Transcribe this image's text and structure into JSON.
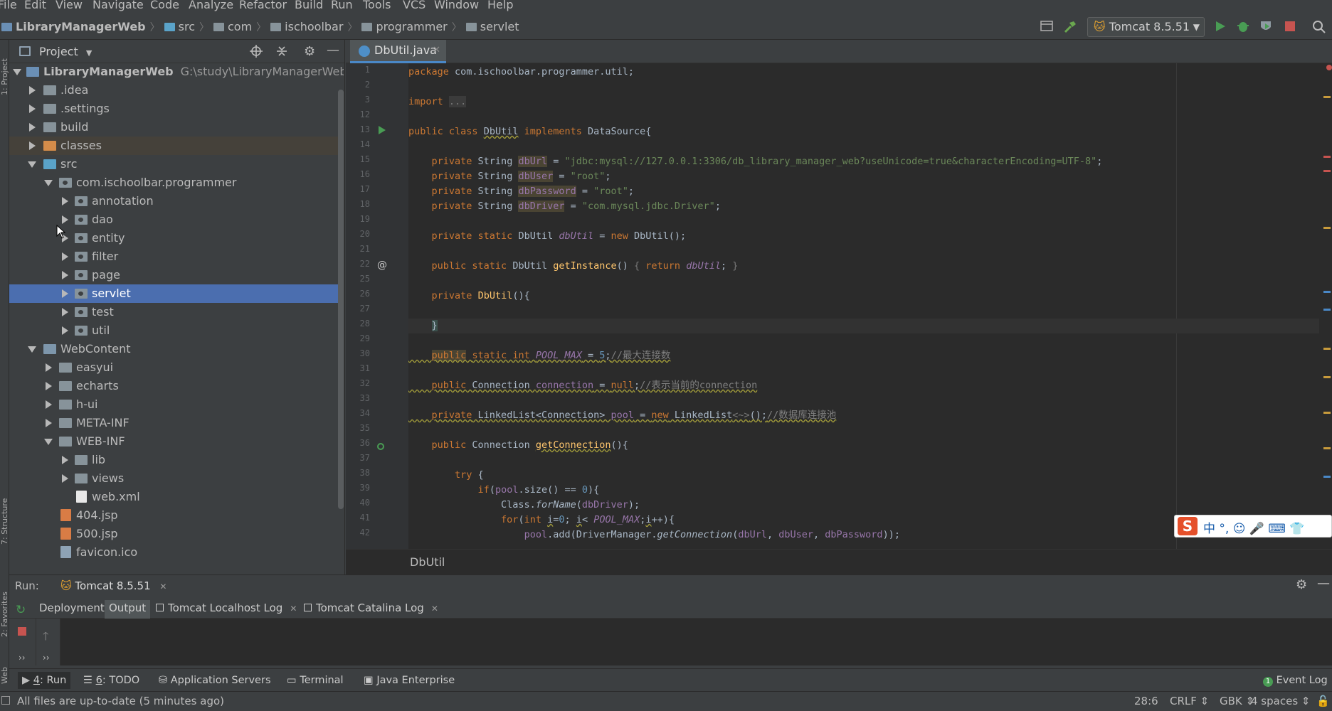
{
  "menu": [
    "File",
    "Edit",
    "View",
    "Navigate",
    "Code",
    "Analyze",
    "Refactor",
    "Build",
    "Run",
    "Tools",
    "VCS",
    "Window",
    "Help"
  ],
  "breadcrumb": [
    "LibraryManagerWeb",
    "src",
    "com",
    "ischoolbar",
    "programmer",
    "servlet"
  ],
  "run_config": "Tomcat 8.5.51",
  "project_panel": {
    "title": "Project",
    "tree": [
      {
        "label": "LibraryManagerWeb",
        "path": "G:\\study\\LibraryManagerWeb"
      },
      {
        "label": ".idea"
      },
      {
        "label": ".settings"
      },
      {
        "label": "build"
      },
      {
        "label": "classes"
      },
      {
        "label": "src"
      },
      {
        "label": "com.ischoolbar.programmer"
      },
      {
        "label": "annotation"
      },
      {
        "label": "dao"
      },
      {
        "label": "entity"
      },
      {
        "label": "filter"
      },
      {
        "label": "page"
      },
      {
        "label": "servlet"
      },
      {
        "label": "test"
      },
      {
        "label": "util"
      },
      {
        "label": "WebContent"
      },
      {
        "label": "easyui"
      },
      {
        "label": "echarts"
      },
      {
        "label": "h-ui"
      },
      {
        "label": "META-INF"
      },
      {
        "label": "WEB-INF"
      },
      {
        "label": "lib"
      },
      {
        "label": "views"
      },
      {
        "label": "web.xml"
      },
      {
        "label": "404.jsp"
      },
      {
        "label": "500.jsp"
      },
      {
        "label": "favicon.ico"
      }
    ]
  },
  "left_stripe": [
    "1: Project",
    "7: Structure",
    "2: Favorites",
    "Web"
  ],
  "editor": {
    "tab": "DbUtil.java",
    "breadcrumb": "DbUtil",
    "line_numbers": [
      "1",
      "2",
      "3",
      "12",
      "13",
      "14",
      "15",
      "16",
      "17",
      "18",
      "19",
      "20",
      "21",
      "22",
      "25",
      "26",
      "27",
      "28",
      "29",
      "30",
      "31",
      "32",
      "33",
      "34",
      "35",
      "36",
      "37",
      "38",
      "39",
      "40",
      "41",
      "42"
    ]
  },
  "ime": {
    "logo": "S",
    "text": "中 °, ☺ 🎤 ⌨ 👕"
  },
  "run_panel": {
    "label": "Run:",
    "config": "Tomcat 8.5.51",
    "tabs": [
      "Deployment",
      "Output",
      "Tomcat Localhost Log",
      "Tomcat Catalina Log"
    ]
  },
  "tool_windows": [
    {
      "key": "4",
      "label": ": Run"
    },
    {
      "key": "6",
      "label": ": TODO"
    },
    {
      "key": "",
      "label": "Application Servers"
    },
    {
      "key": "",
      "label": "Terminal"
    },
    {
      "key": "",
      "label": "Java Enterprise"
    }
  ],
  "event_log": "Event Log",
  "status": {
    "message": "All files are up-to-date (5 minutes ago)",
    "position": "28:6",
    "line_sep": "CRLF",
    "encoding": "GBK",
    "indent": "4 spaces"
  },
  "colors": {
    "selection": "#4b6eaf",
    "accent_tab": "#4a88c7",
    "keyword": "#cc7832",
    "string": "#6a8759"
  }
}
